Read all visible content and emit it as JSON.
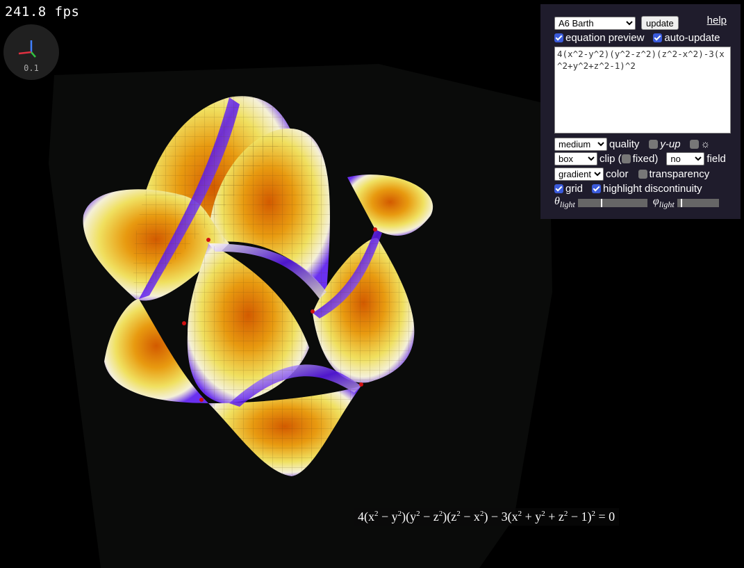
{
  "fps": "241.8 fps",
  "axes_gizmo": {
    "scale": "0.1"
  },
  "panel": {
    "preset": {
      "selected": "A6 Barth"
    },
    "update_label": "update",
    "help_label": "help",
    "equation_preview_label": "equation preview",
    "auto_update_label": "auto-update",
    "equation_text": "4(x^2-y^2)(y^2-z^2)(z^2-x^2)-3(x^2+y^2+z^2-1)^2",
    "quality": {
      "selected": "medium",
      "label": "quality"
    },
    "y_up_label": "y-up",
    "light_icon": "sun-icon",
    "clip": {
      "selected": "box",
      "label": "clip ("
    },
    "fixed_label": "fixed)",
    "field": {
      "selected": "no",
      "label": "field"
    },
    "color": {
      "selected": "gradient",
      "label": "color"
    },
    "transparency_label": "transparency",
    "grid_label": "grid",
    "highlight_label": "highlight discontinuity",
    "theta_symbol": "θ",
    "phi_symbol": "φ",
    "light_sub": "light",
    "theta_value": 0.33,
    "phi_value": 0.08,
    "checkboxes": {
      "equation_preview": true,
      "auto_update": true,
      "y_up": false,
      "light": false,
      "fixed": false,
      "transparency": false,
      "grid": true,
      "highlight": true
    }
  },
  "colors": {
    "panel_bg": "#1f1c2c",
    "checkbox_on": "#3b5bdb",
    "surface_gold": "#e8a400",
    "surface_purple": "#5010e0"
  }
}
